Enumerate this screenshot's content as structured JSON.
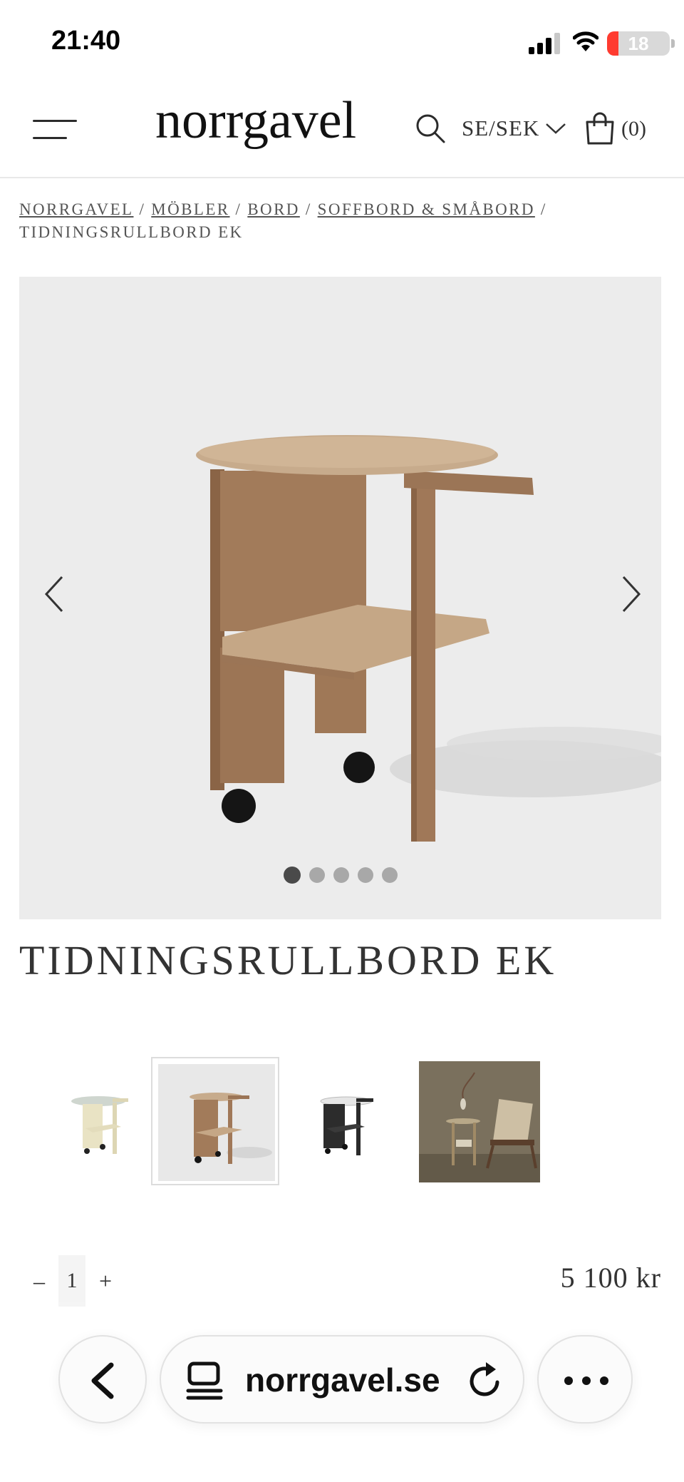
{
  "status_bar": {
    "time": "21:40",
    "battery_level": "18"
  },
  "header": {
    "logo": "norrgavel",
    "currency": "SE/SEK",
    "cart_count": "(0)"
  },
  "breadcrumb": {
    "links": [
      "NORRGAVEL",
      "MÖBLER",
      "BORD",
      "SOFFBORD & SMÅBORD"
    ],
    "separator": "/",
    "current": "TIDNINGSRULLBORD EK"
  },
  "gallery": {
    "total_slides": 5,
    "active_slide": 1
  },
  "product": {
    "title": "TIDNINGSRULLBORD EK",
    "quantity": "1",
    "minus_label": "–",
    "plus_label": "+",
    "price": "5 100 kr"
  },
  "thumbnails": [
    {
      "variant": "cream-lacquered",
      "selected": false
    },
    {
      "variant": "oak",
      "selected": true
    },
    {
      "variant": "black",
      "selected": false
    },
    {
      "variant": "room-setting",
      "selected": false
    }
  ],
  "browser": {
    "url": "norrgavel.se"
  },
  "colors": {
    "gallery_bg": "#ececec",
    "oak": "#a27b5a",
    "text": "#2b2b2b"
  }
}
